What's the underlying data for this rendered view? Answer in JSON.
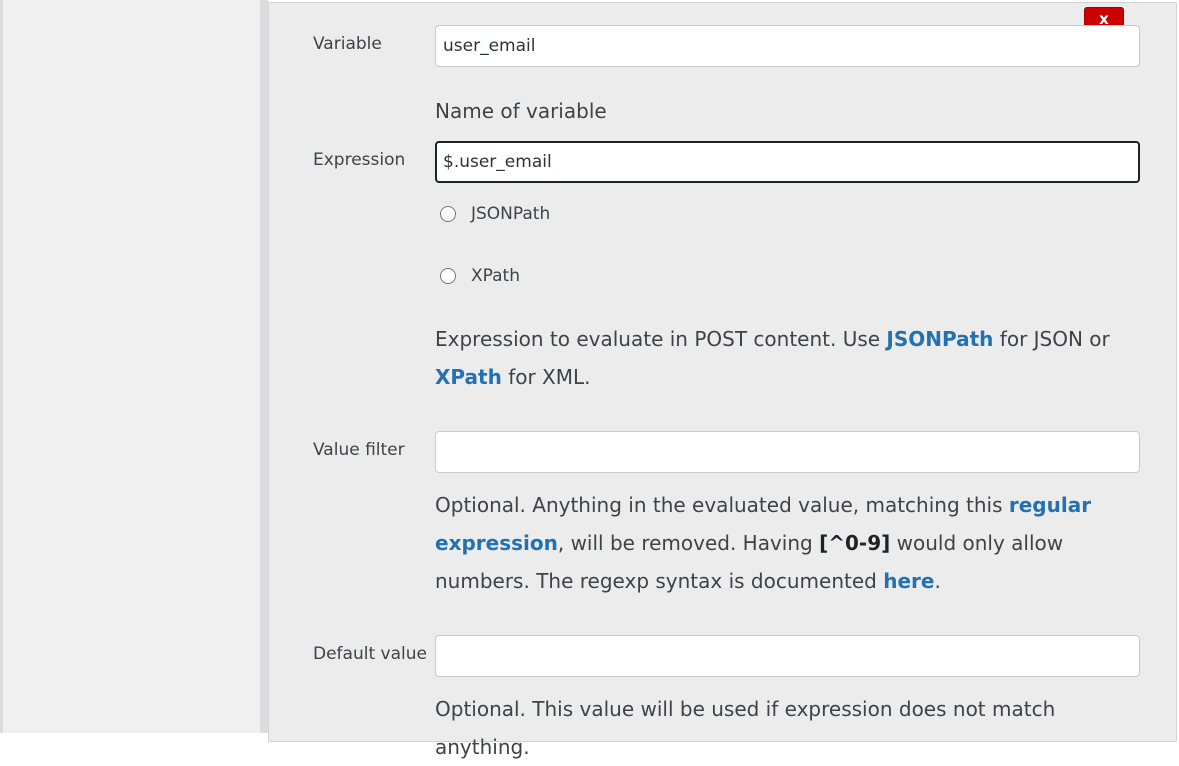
{
  "remove_button": {
    "label": "x"
  },
  "variable": {
    "label": "Variable",
    "value": "user_email",
    "help": "Name of variable"
  },
  "expression": {
    "label": "Expression",
    "value": "$.user_email",
    "options": [
      {
        "label": "JSONPath",
        "checked": false
      },
      {
        "label": "XPath",
        "checked": false
      }
    ],
    "help_prefix": "Expression to evaluate in POST content. Use ",
    "help_link1": "JSONPath",
    "help_mid": " for JSON or ",
    "help_link2": "XPath",
    "help_suffix": " for XML."
  },
  "value_filter": {
    "label": "Value filter",
    "value": "",
    "help_prefix": "Optional. Anything in the evaluated value, matching this ",
    "help_link": "regular expression",
    "help_mid": ", will be removed. Having ",
    "help_code": "[^0-9]",
    "help_mid2": " would only allow numbers. The regexp syntax is documented ",
    "help_link2": "here",
    "help_suffix": "."
  },
  "default_value": {
    "label": "Default value",
    "value": "",
    "help": "Optional. This value will be used if expression does not match anything."
  }
}
